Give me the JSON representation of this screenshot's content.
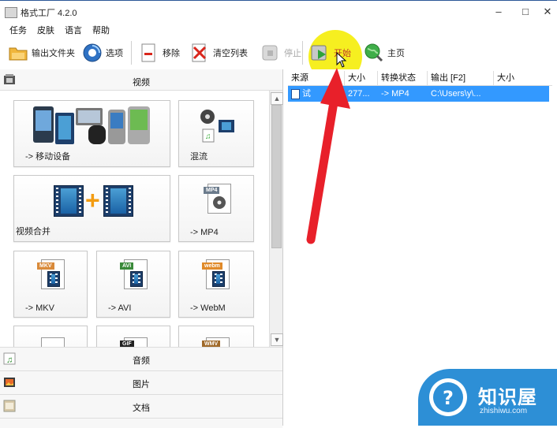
{
  "window": {
    "title": "格式工厂 4.2.0",
    "min": "–",
    "max": "□",
    "close": "✕"
  },
  "menu": [
    "任务",
    "皮肤",
    "语言",
    "帮助"
  ],
  "toolbar": {
    "output_folder": "输出文件夹",
    "options": "选项",
    "remove": "移除",
    "clear_list": "清空列表",
    "stop": "停止",
    "start": "开始",
    "home": "主页"
  },
  "left": {
    "video_category": "视频",
    "tiles": [
      {
        "label": "-> 移动设备"
      },
      {
        "label": "混流"
      },
      {
        "label": "视频合并"
      },
      {
        "label": "-> MP4",
        "tag": "MP4"
      },
      {
        "label": "-> MKV",
        "tag": "MKV"
      },
      {
        "label": "-> AVI",
        "tag": "AVI"
      },
      {
        "label": "-> WebM",
        "tag": "webm"
      },
      {
        "label": "",
        "tag": ""
      },
      {
        "label": "",
        "tag": "GIF"
      },
      {
        "label": "",
        "tag": "WMV"
      }
    ],
    "categories": [
      "音频",
      "图片",
      "文档"
    ]
  },
  "list": {
    "columns": [
      "来源",
      "大小",
      "转换状态",
      "输出 [F2]",
      "大小"
    ],
    "rows": [
      {
        "source": "试",
        "size": "277...",
        "status": "-> MP4",
        "output": "C:\\Users\\y\\..."
      }
    ]
  },
  "watermark": {
    "title": "知识屋",
    "url": "zhishiwu.com"
  },
  "colors": {
    "selection": "#3399ff",
    "highlight": "#f6ee14",
    "arrow": "#e8202a"
  }
}
